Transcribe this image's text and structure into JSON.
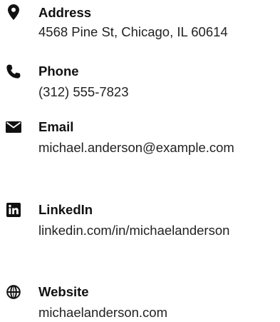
{
  "contact": {
    "items": [
      {
        "icon": "map-marker-icon",
        "label": "Address",
        "value": "4568 Pine St, Chicago, IL 60614"
      },
      {
        "icon": "phone-icon",
        "label": "Phone",
        "value": "(312) 555-7823"
      },
      {
        "icon": "envelope-icon",
        "label": "Email",
        "value": "michael.anderson@example.com"
      },
      {
        "icon": "linkedin-icon",
        "label": "LinkedIn",
        "value": "linkedin.com/in/michaelanderson"
      },
      {
        "icon": "globe-icon",
        "label": "Website",
        "value": "michaelanderson.com"
      }
    ]
  },
  "colors": {
    "icon": "#111111",
    "label": "#111111",
    "text": "#222222"
  }
}
